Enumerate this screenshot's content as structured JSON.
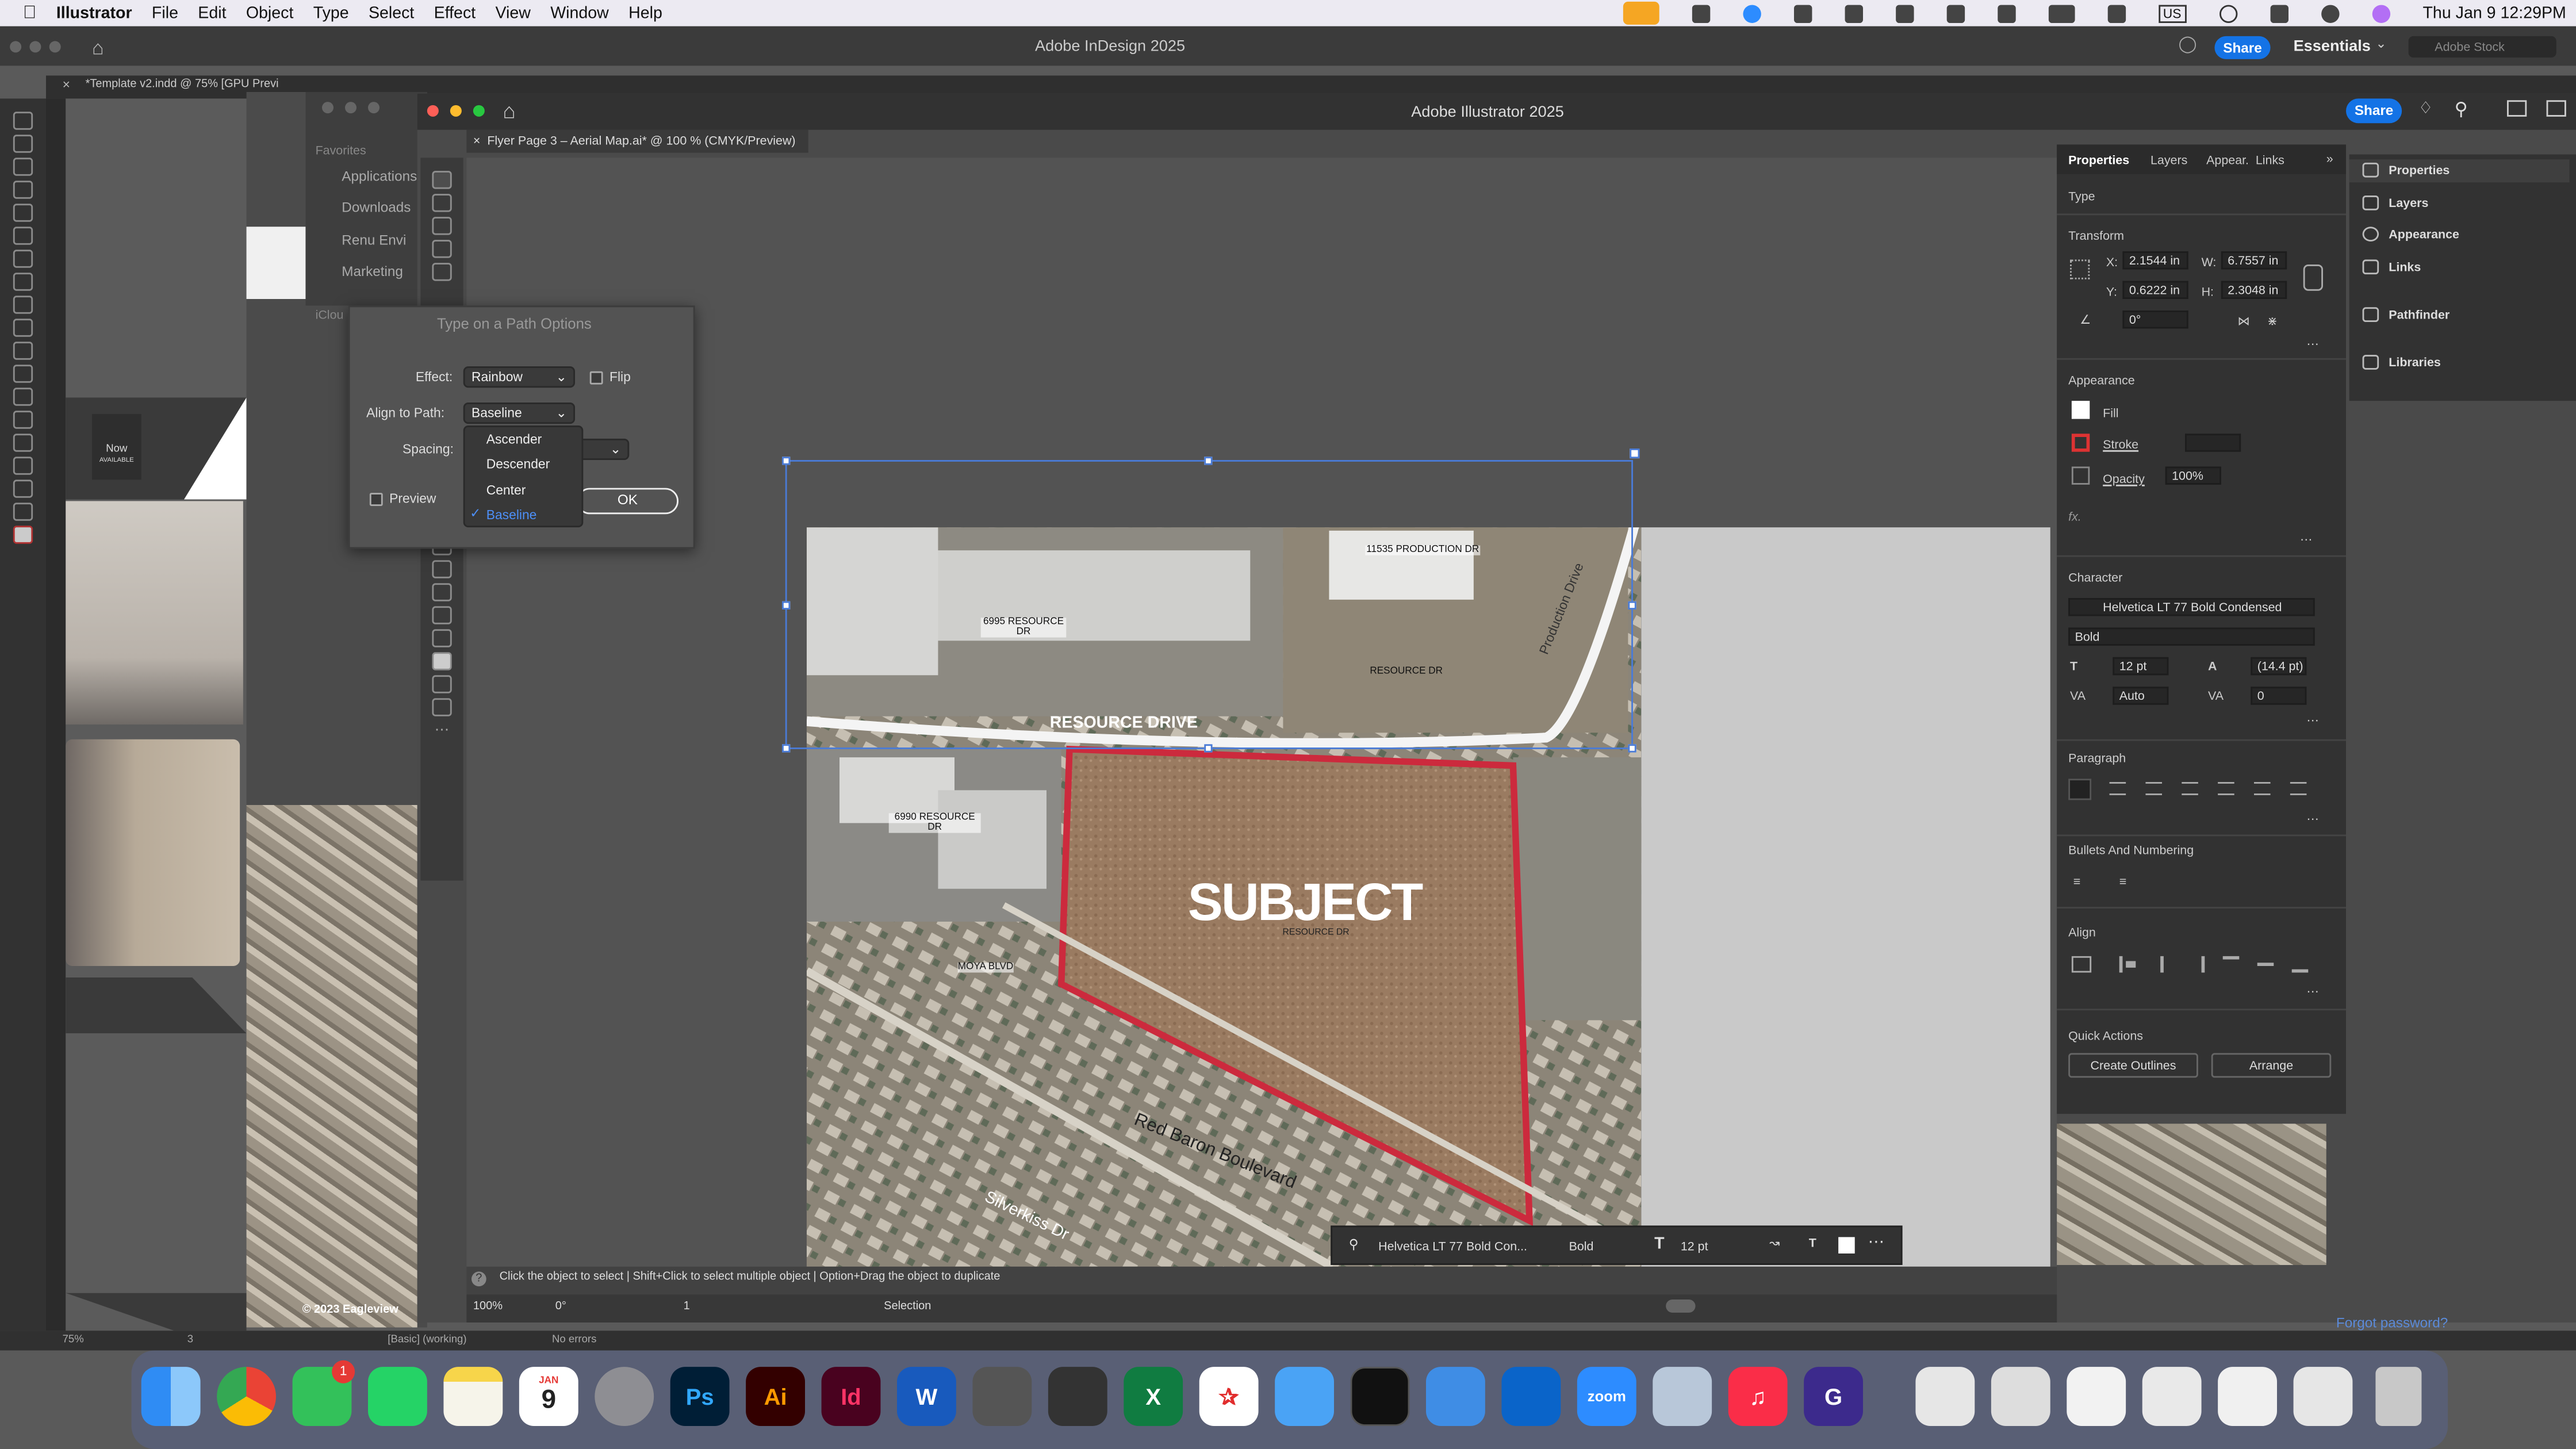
{
  "menubar": {
    "app": "Illustrator",
    "items": [
      "File",
      "Edit",
      "Object",
      "Type",
      "Select",
      "Effect",
      "View",
      "Window",
      "Help"
    ],
    "clock": "Thu Jan 9  12:29PM",
    "input_source": "US"
  },
  "indesign": {
    "title": "Adobe InDesign 2025",
    "doc_tab": "*Template v2.indd @ 75% [GPU Previ",
    "share": "Share",
    "workspace": "Essentials",
    "search_placeholder": "Adobe Stock",
    "zoom": "75%",
    "page": "3",
    "style": "[Basic] (working)",
    "errors": "No errors"
  },
  "finder": {
    "favorites": "Favorites",
    "items": [
      "Applications",
      "Downloads",
      "Renu Envi",
      "Marketing"
    ],
    "icloud": "iClou"
  },
  "thumbs": {
    "now_label": "Now",
    "now_sub": "AVAILABLE"
  },
  "illustrator": {
    "title": "Adobe Illustrator 2025",
    "doc_tab": "Flyer Page 3 – Aerial Map.ai* @ 100 % (CMYK/Preview)",
    "share": "Share"
  },
  "dialog": {
    "title": "Type on a Path Options",
    "effect_label": "Effect:",
    "effect_value": "Rainbow",
    "flip_label": "Flip",
    "align_label": "Align to Path:",
    "align_value": "Baseline",
    "spacing_label": "Spacing:",
    "preview_label": "Preview",
    "ok_label": "OK",
    "options": [
      "Ascender",
      "Descender",
      "Center",
      "Baseline"
    ],
    "selected": "Baseline"
  },
  "map": {
    "subject": "SUBJECT",
    "road": "RESOURCE DRIVE",
    "labels": [
      "6995 RESOURCE DR",
      "11535 PRODUCTION DR",
      "RESOURCE DR",
      "6990 RESOURCE DR",
      "RESOURCE DR",
      "MOYA BLVD",
      "Red Baron Boulevard",
      "Silverkiss Dr"
    ],
    "copyright": "© 2023 Eagleview",
    "production_dr": "Production Drive"
  },
  "properties": {
    "tabs": [
      "Properties",
      "Layers",
      "Appear.",
      "Links"
    ],
    "type_label": "Type",
    "transform": "Transform",
    "x_label": "X:",
    "x": "2.1544 in",
    "y_label": "Y:",
    "y": "0.6222 in",
    "w_label": "W:",
    "w": "6.7557 in",
    "h_label": "H:",
    "h": "2.3048 in",
    "angle": "0°",
    "appearance": "Appearance",
    "fill": "Fill",
    "stroke": "Stroke",
    "opacity_label": "Opacity",
    "opacity": "100%",
    "fx": "fx.",
    "character": "Character",
    "font": "Helvetica LT 77 Bold Condensed",
    "style": "Bold",
    "size": "12 pt",
    "leading": "(14.4 pt)",
    "kerning": "Auto",
    "tracking": "0",
    "paragraph": "Paragraph",
    "bullets": "Bullets And Numbering",
    "align": "Align",
    "quick_actions": "Quick Actions",
    "create_outlines": "Create Outlines",
    "arrange": "Arrange"
  },
  "right_panels": [
    "Properties",
    "Layers",
    "Appearance",
    "Links",
    "Pathfinder",
    "Libraries"
  ],
  "status": {
    "hint": "Click the object to select | Shift+Click to select multiple object | Option+Drag the object to duplicate",
    "zoom": "100%",
    "angle": "0°",
    "artboard": "1",
    "tool": "Selection"
  },
  "context_bar": {
    "font": "Helvetica LT 77 Bold Con...",
    "style": "Bold",
    "size": "12 pt"
  },
  "forgot": "Forgot password?",
  "dock": {
    "calendar_month": "JAN",
    "calendar_day": "9",
    "badge": "1",
    "apps": [
      "Ps",
      "Ai",
      "Id",
      "W",
      "X",
      "zoom"
    ]
  }
}
